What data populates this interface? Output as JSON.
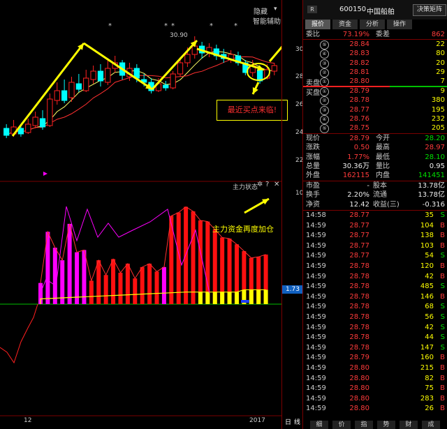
{
  "toolbar": {
    "hide_label": "隐藏",
    "assist_label": "智能辅助"
  },
  "chart": {
    "price_axis": [
      "30",
      "28",
      "26",
      "24",
      "22"
    ],
    "peak_label": "30.90",
    "annotation": "最近买点来临!",
    "indicator_name": "主力状态",
    "indicator_note": "主力资金再度加仓",
    "indicator_axis_top": "10",
    "indicator_value": "1.73",
    "x_label_left": "12",
    "x_label_right": "2017",
    "bottom_mode_a": "日",
    "bottom_mode_b": "线"
  },
  "candles": [
    {
      "o": 24.3,
      "c": 23.8,
      "h": 24.6,
      "l": 23.6
    },
    {
      "o": 23.9,
      "c": 24.4,
      "h": 24.9,
      "l": 23.7
    },
    {
      "o": 24.3,
      "c": 23.9,
      "h": 24.6,
      "l": 23.7
    },
    {
      "o": 24.0,
      "c": 24.6,
      "h": 25.0,
      "l": 23.9
    },
    {
      "o": 24.5,
      "c": 25.1,
      "h": 25.5,
      "l": 24.3
    },
    {
      "o": 25.0,
      "c": 24.4,
      "h": 25.6,
      "l": 24.2
    },
    {
      "o": 24.5,
      "c": 26.4,
      "h": 26.8,
      "l": 24.4
    },
    {
      "o": 26.3,
      "c": 27.0,
      "h": 27.6,
      "l": 26.0
    },
    {
      "o": 27.0,
      "c": 26.3,
      "h": 27.8,
      "l": 26.1
    },
    {
      "o": 26.5,
      "c": 27.6,
      "h": 28.0,
      "l": 26.2
    },
    {
      "o": 27.5,
      "c": 27.1,
      "h": 28.2,
      "l": 26.9
    },
    {
      "o": 27.0,
      "c": 27.9,
      "h": 28.5,
      "l": 26.9
    },
    {
      "o": 27.8,
      "c": 28.4,
      "h": 28.8,
      "l": 27.5
    },
    {
      "o": 28.4,
      "c": 27.7,
      "h": 28.9,
      "l": 27.3
    },
    {
      "o": 27.6,
      "c": 28.6,
      "h": 29.2,
      "l": 27.4
    },
    {
      "o": 28.6,
      "c": 29.0,
      "h": 29.5,
      "l": 28.3
    },
    {
      "o": 29.0,
      "c": 28.1,
      "h": 29.2,
      "l": 27.8
    },
    {
      "o": 28.0,
      "c": 28.6,
      "h": 29.0,
      "l": 27.7
    },
    {
      "o": 28.6,
      "c": 27.9,
      "h": 28.9,
      "l": 27.6
    },
    {
      "o": 27.8,
      "c": 27.6,
      "h": 28.2,
      "l": 27.3
    },
    {
      "o": 27.6,
      "c": 27.0,
      "h": 27.9,
      "l": 26.8
    },
    {
      "o": 27.0,
      "c": 27.5,
      "h": 27.9,
      "l": 26.9
    },
    {
      "o": 27.4,
      "c": 27.2,
      "h": 27.7,
      "l": 27.0
    },
    {
      "o": 27.2,
      "c": 28.2,
      "h": 28.4,
      "l": 27.1
    },
    {
      "o": 28.2,
      "c": 29.0,
      "h": 29.4,
      "l": 28.0
    },
    {
      "o": 29.0,
      "c": 29.6,
      "h": 30.1,
      "l": 28.7
    },
    {
      "o": 29.6,
      "c": 30.2,
      "h": 30.9,
      "l": 29.3
    },
    {
      "o": 30.2,
      "c": 29.7,
      "h": 30.5,
      "l": 29.3
    },
    {
      "o": 29.7,
      "c": 30.1,
      "h": 30.4,
      "l": 29.4
    },
    {
      "o": 30.0,
      "c": 29.5,
      "h": 30.3,
      "l": 29.2
    },
    {
      "o": 29.6,
      "c": 29.3,
      "h": 30.0,
      "l": 29.0
    },
    {
      "o": 29.2,
      "c": 29.6,
      "h": 29.9,
      "l": 29.0
    },
    {
      "o": 29.5,
      "c": 29.0,
      "h": 29.8,
      "l": 28.8
    },
    {
      "o": 29.0,
      "c": 28.3,
      "h": 29.2,
      "l": 28.1
    },
    {
      "o": 28.3,
      "c": 28.8,
      "h": 29.2,
      "l": 28.0
    },
    {
      "o": 28.5,
      "c": 27.7,
      "h": 28.8,
      "l": 27.5
    },
    {
      "o": 27.9,
      "c": 28.5,
      "h": 28.9,
      "l": 27.8
    },
    {
      "o": 28.4,
      "c": 28.8,
      "h": 29.0,
      "l": 28.1
    }
  ],
  "indicator_bars": [
    {
      "h": 0,
      "c": "none"
    },
    {
      "h": 0,
      "c": "none"
    },
    {
      "h": 0,
      "c": "none"
    },
    {
      "h": 0,
      "c": "none"
    },
    {
      "h": 0,
      "c": "none"
    },
    {
      "h": 0,
      "c": "none"
    },
    {
      "h": 1.8,
      "c": "magenta"
    },
    {
      "h": 6.3,
      "c": "magenta"
    },
    {
      "h": 4.9,
      "c": "magenta"
    },
    {
      "h": 3.8,
      "c": "magenta"
    },
    {
      "h": 7.0,
      "c": "magenta"
    },
    {
      "h": 4.5,
      "c": "magenta"
    },
    {
      "h": 4.7,
      "c": "magenta"
    },
    {
      "h": 2.0,
      "c": "red"
    },
    {
      "h": 3.8,
      "c": "red"
    },
    {
      "h": 2.5,
      "c": "red"
    },
    {
      "h": 3.9,
      "c": "red"
    },
    {
      "h": 2.7,
      "c": "red"
    },
    {
      "h": 3.5,
      "c": "red"
    },
    {
      "h": 2.2,
      "c": "red"
    },
    {
      "h": 3.2,
      "c": "red"
    },
    {
      "h": 3.5,
      "c": "red"
    },
    {
      "h": 2.8,
      "c": "red"
    },
    {
      "h": 3.2,
      "c": "magenta"
    },
    {
      "h": 7.7,
      "c": "red"
    },
    {
      "h": 8.0,
      "c": "red"
    },
    {
      "h": 8.5,
      "c": "red"
    },
    {
      "h": 8.1,
      "c": "red"
    },
    {
      "h": 7.3,
      "c": "red"
    },
    {
      "h": 7.2,
      "c": "red"
    },
    {
      "h": 6.5,
      "c": "red"
    },
    {
      "h": 5.8,
      "c": "red"
    },
    {
      "h": 5.7,
      "c": "red"
    },
    {
      "h": 5.2,
      "c": "red"
    },
    {
      "h": 4.6,
      "c": "red"
    },
    {
      "h": 4.0,
      "c": "red"
    },
    {
      "h": 4.1,
      "c": "red"
    },
    {
      "h": 4.3,
      "c": "red"
    }
  ],
  "quote": {
    "badge": "R",
    "code": "600150",
    "name": "中国船舶",
    "matrix_button": "决策矩阵",
    "tabs": [
      "报价",
      "资金",
      "分析",
      "操作"
    ],
    "wb_label": "委比",
    "wb_value": "73.19%",
    "wc_label": "委差",
    "wc_value": "862",
    "sells": [
      {
        "n": "⑤",
        "p": "28.84",
        "v": "22"
      },
      {
        "n": "④",
        "p": "28.83",
        "v": "80"
      },
      {
        "n": "③",
        "p": "28.82",
        "v": "20"
      },
      {
        "n": "②",
        "p": "28.81",
        "v": "29"
      },
      {
        "n": "①",
        "p": "28.80",
        "v": "7"
      }
    ],
    "sell_label": "卖盘",
    "buy_label": "买盘",
    "buys": [
      {
        "n": "①",
        "p": "28.79",
        "v": "9"
      },
      {
        "n": "②",
        "p": "28.78",
        "v": "380"
      },
      {
        "n": "③",
        "p": "28.77",
        "v": "195"
      },
      {
        "n": "④",
        "p": "28.76",
        "v": "232"
      },
      {
        "n": "⑤",
        "p": "28.75",
        "v": "205"
      }
    ],
    "stats": [
      {
        "l1": "现价",
        "v1": "28.79",
        "c1": "red",
        "l2": "今开",
        "v2": "28.20",
        "c2": "grn"
      },
      {
        "l1": "涨跌",
        "v1": "0.50",
        "c1": "red",
        "l2": "最高",
        "v2": "28.97",
        "c2": "red"
      },
      {
        "l1": "涨幅",
        "v1": "1.77%",
        "c1": "red",
        "l2": "最低",
        "v2": "28.10",
        "c2": "grn"
      },
      {
        "l1": "总量",
        "v1": "30.36万",
        "c1": "wht",
        "l2": "量比",
        "v2": "0.95",
        "c2": "wht"
      },
      {
        "l1": "外盘",
        "v1": "162115",
        "c1": "red",
        "l2": "内盘",
        "v2": "141451",
        "c2": "grn"
      }
    ],
    "fund": [
      {
        "l1": "市盈",
        "v1": "-",
        "l2": "股本",
        "v2": "13.78亿"
      },
      {
        "l1": "换手",
        "v1": "2.20%",
        "l2": "流通",
        "v2": "13.78亿"
      },
      {
        "l1": "净资",
        "v1": "12.42",
        "l2": "收益(三)",
        "v2": "-0.316"
      }
    ],
    "trades": [
      {
        "t": "14:58",
        "p": "28.77",
        "v": "35",
        "s": "S"
      },
      {
        "t": "14:59",
        "p": "28.77",
        "v": "104",
        "s": "B"
      },
      {
        "t": "14:59",
        "p": "28.77",
        "v": "138",
        "s": "B"
      },
      {
        "t": "14:59",
        "p": "28.77",
        "v": "103",
        "s": "B"
      },
      {
        "t": "14:59",
        "p": "28.77",
        "v": "54",
        "s": "S"
      },
      {
        "t": "14:59",
        "p": "28.78",
        "v": "120",
        "s": "B"
      },
      {
        "t": "14:59",
        "p": "28.78",
        "v": "42",
        "s": "B"
      },
      {
        "t": "14:59",
        "p": "28.78",
        "v": "485",
        "s": "S"
      },
      {
        "t": "14:59",
        "p": "28.78",
        "v": "146",
        "s": "B"
      },
      {
        "t": "14:59",
        "p": "28.78",
        "v": "68",
        "s": "S"
      },
      {
        "t": "14:59",
        "p": "28.78",
        "v": "56",
        "s": "S"
      },
      {
        "t": "14:59",
        "p": "28.78",
        "v": "42",
        "s": "S"
      },
      {
        "t": "14:59",
        "p": "28.78",
        "v": "44",
        "s": "S"
      },
      {
        "t": "14:59",
        "p": "28.78",
        "v": "147",
        "s": "S"
      },
      {
        "t": "14:59",
        "p": "28.79",
        "v": "160",
        "s": "B"
      },
      {
        "t": "14:59",
        "p": "28.80",
        "v": "215",
        "s": "B"
      },
      {
        "t": "14:59",
        "p": "28.80",
        "v": "82",
        "s": "B"
      },
      {
        "t": "14:59",
        "p": "28.80",
        "v": "75",
        "s": "B"
      },
      {
        "t": "14:59",
        "p": "28.80",
        "v": "283",
        "s": "B"
      },
      {
        "t": "14:59",
        "p": "28.80",
        "v": "26",
        "s": "B"
      }
    ],
    "bottom_tabs": [
      "细",
      "价",
      "指",
      "势",
      "财",
      "成"
    ]
  },
  "colors": {
    "up": "#ff2020",
    "down": "#00ffff",
    "ma1": "#ffff66",
    "ma2": "#ff3030",
    "arrow": "#ffff00"
  }
}
